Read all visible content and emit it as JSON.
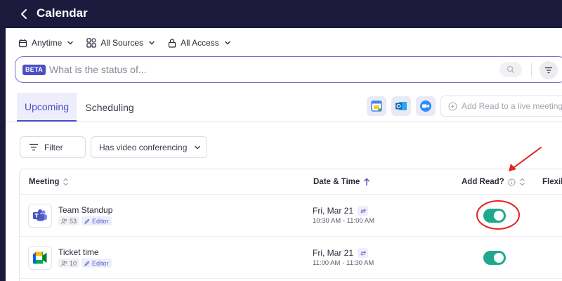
{
  "header": {
    "title": "Calendar"
  },
  "filters": [
    {
      "label": "Anytime",
      "icon": "calendar-icon"
    },
    {
      "label": "All Sources",
      "icon": "sources-icon"
    },
    {
      "label": "All Access",
      "icon": "lock-icon"
    }
  ],
  "search": {
    "badge": "BETA",
    "placeholder": "What is the status of..."
  },
  "tabs": [
    {
      "label": "Upcoming",
      "active": true
    },
    {
      "label": "Scheduling",
      "active": false
    }
  ],
  "integrations": [
    "google-calendar-icon",
    "outlook-icon",
    "zoom-icon"
  ],
  "add_read": {
    "label": "Add Read to a live meeting"
  },
  "table_filters": {
    "filter_label": "Filter",
    "video_label": "Has video conferencing"
  },
  "table": {
    "columns": {
      "meeting": "Meeting",
      "datetime": "Date & Time",
      "add_read": "Add Read?",
      "flex": "Flexil"
    },
    "rows": [
      {
        "name": "Team Standup",
        "app": "microsoft-teams-icon",
        "attendees": "53",
        "role": "Editor",
        "date": "Fri, Mar 21",
        "time": "10:30 AM - 11:00 AM",
        "add_read": true
      },
      {
        "name": "Ticket time",
        "app": "google-meet-icon",
        "attendees": "10",
        "role": "Editor",
        "date": "Fri, Mar 21",
        "time": "11:00 AM - 11:30 AM",
        "add_read": true
      }
    ]
  },
  "colors": {
    "accent": "#4b4fc4",
    "toggle_on": "#1ea98d",
    "header_bg": "#1b1a3d",
    "annotation": "#e02424"
  }
}
